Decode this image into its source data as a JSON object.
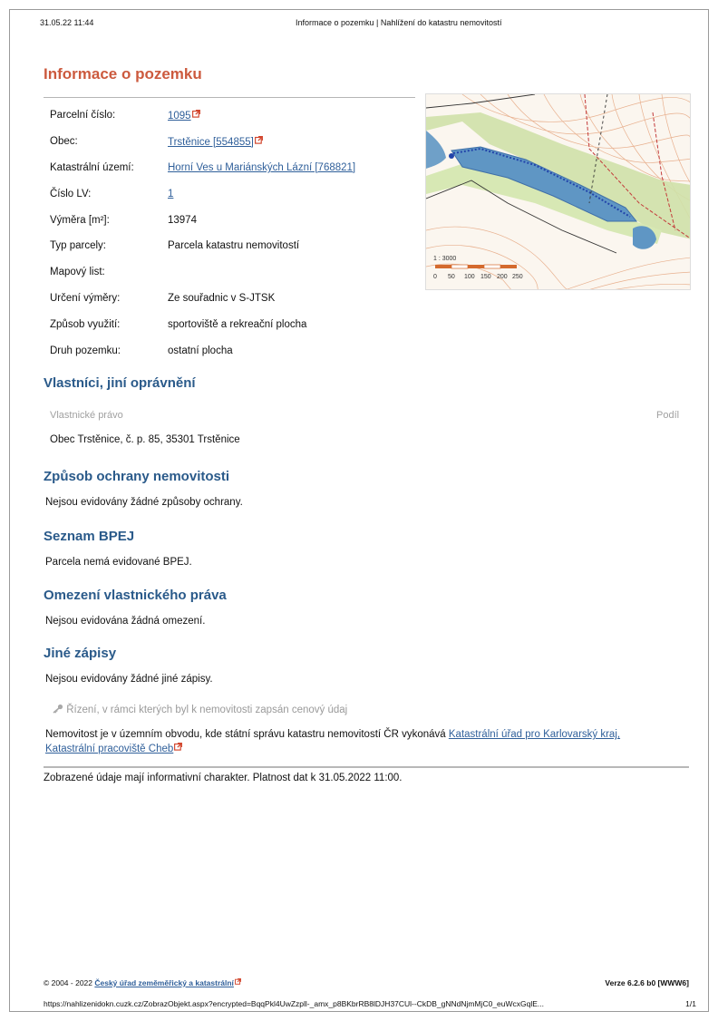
{
  "print_header": {
    "date": "31.05.22 11:44",
    "title": "Informace o pozemku | Nahlížení do katastru nemovitostí"
  },
  "page_title": "Informace o pozemku",
  "parcel_info": {
    "rows": [
      {
        "label": "Parcelní číslo:",
        "value": "1095"
      },
      {
        "label": "Obec:",
        "value": "Trstěnice [554855]"
      },
      {
        "label": "Katastrální území:",
        "value": "Horní Ves u Mariánských Lázní [768821]"
      },
      {
        "label": "Číslo LV:",
        "value": "1"
      },
      {
        "label": "Výměra [m²]:",
        "value": "13974"
      },
      {
        "label": "Typ parcely:",
        "value": "Parcela katastru nemovitostí"
      },
      {
        "label": "Mapový list:",
        "value": ""
      },
      {
        "label": "Určení výměry:",
        "value": "Ze souřadnic v S-JTSK"
      },
      {
        "label": "Způsob využití:",
        "value": "sportoviště a rekreační plocha"
      },
      {
        "label": "Druh pozemku:",
        "value": "ostatní plocha"
      }
    ]
  },
  "map": {
    "scale_ratio": "1 : 3000",
    "scale_ticks": [
      "0",
      "50",
      "100",
      "150",
      "200",
      "250"
    ]
  },
  "owners": {
    "heading": "Vlastníci, jiní oprávnění",
    "column_right": "Vlastnické právo",
    "column_share": "Podíl",
    "entries": [
      "Obec Trstěnice, č. p. 85, 35301 Trstěnice"
    ]
  },
  "sections": [
    {
      "heading": "Způsob ochrany nemovitosti",
      "text": "Nejsou evidovány žádné způsoby ochrany."
    },
    {
      "heading": "Seznam BPEJ",
      "text": "Parcela nemá evidované BPEJ."
    },
    {
      "heading": "Omezení vlastnického práva",
      "text": "Nejsou evidována žádná omezení."
    },
    {
      "heading": "Jiné zápisy",
      "text": "Nejsou evidovány žádné jiné zápisy."
    }
  ],
  "proceedings_note": "Řízení, v rámci kterých byl k nemovitosti zapsán cenový údaj",
  "office": {
    "text": "Nemovitost je v územním obvodu, kde státní správu katastru nemovitostí ČR vykonává ",
    "link1": "Katastrální úřad pro Karlovarský kraj,",
    "link2": "Katastrální pracoviště Cheb"
  },
  "validity_note": "Zobrazené údaje mají informativní charakter. Platnost dat k 31.05.2022 11:00.",
  "footer": {
    "copyright": "© 2004 - 2022 ",
    "agency_link": "Český úřad zeměměřický a katastrální",
    "version": "Verze 6.2.6 b0 [WWW6]"
  },
  "print_footer": {
    "url": "https://nahlizenidokn.cuzk.cz/ZobrazObjekt.aspx?encrypted=BqqPkl4UwZzpll-_amx_p8BKbrRB8lDJH37CUl--CkDB_gNNdNjmMjC0_euWcxGqlE...",
    "page": "1/1"
  },
  "colors": {
    "title_accent": "#cc5a3e",
    "section_heading": "#2a5a8a",
    "link": "#2f5f9a"
  }
}
